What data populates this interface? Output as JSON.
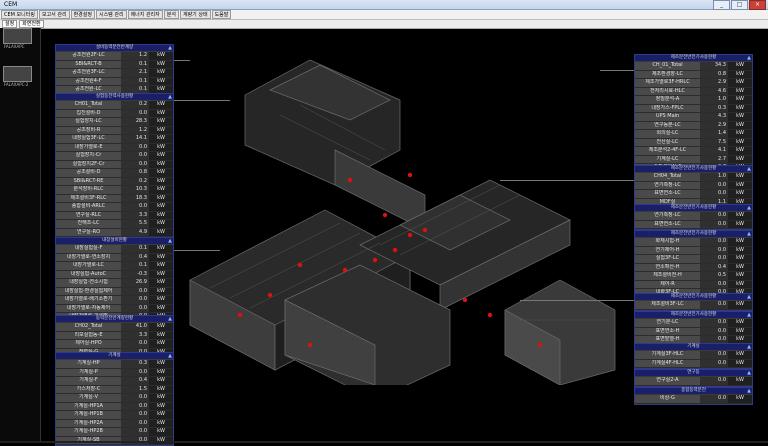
{
  "window": {
    "title": "CEM",
    "buttons": [
      "_",
      "□",
      "×"
    ]
  },
  "menubar": {
    "items": [
      "CEM 모니터링",
      "보고서 관리",
      "환경설정",
      "시스템 관리",
      "에너지 관리자",
      "분석",
      "계량기 상태",
      "도움말"
    ]
  },
  "toolbar": {
    "items": [
      "설정",
      "화면전환"
    ]
  },
  "thumbnails": [
    {
      "label": "FALAXAPC"
    },
    {
      "label": "FALAXAPC-2"
    }
  ],
  "panels": {
    "p1": {
      "title": "설비동력분전반계량",
      "rows": [
        {
          "name": "공조전원2F-LC",
          "value": "1.2",
          "unit": "kW"
        },
        {
          "name": "SBI&RCT-B",
          "value": "0.1",
          "unit": "kW"
        },
        {
          "name": "공조전원3F-LC",
          "value": "2.1",
          "unit": "kW"
        },
        {
          "name": "공조전원4-F",
          "value": "0.1",
          "unit": "kW"
        },
        {
          "name": "공조전원-LC",
          "value": "0.1",
          "unit": "kW"
        }
      ]
    },
    "p2": {
      "title": "실험동전력사용현황",
      "rows": [
        {
          "name": "CH01_Total",
          "value": "0.2",
          "unit": "kW"
        },
        {
          "name": "집진설비-D",
          "value": "0.0",
          "unit": "kW"
        },
        {
          "name": "실험장치-LC",
          "value": "28.3",
          "unit": "kW"
        },
        {
          "name": "공조장비-R",
          "value": "1.2",
          "unit": "kW"
        },
        {
          "name": "내장실험3F-LC",
          "value": "14.1",
          "unit": "kW"
        },
        {
          "name": "내장가열로-E",
          "value": "0.0",
          "unit": "kW"
        },
        {
          "name": "실험장치-Cr",
          "value": "0.0",
          "unit": "kW"
        },
        {
          "name": "실험장치2F-Cr",
          "value": "0.0",
          "unit": "kW"
        },
        {
          "name": "공조설비-D",
          "value": "0.8",
          "unit": "kW"
        },
        {
          "name": "SBI&RCT-RE",
          "value": "0.2",
          "unit": "kW"
        },
        {
          "name": "분석장비-RLC",
          "value": "10.3",
          "unit": "kW"
        },
        {
          "name": "제조설비3F-RLC",
          "value": "18.3",
          "unit": "kW"
        },
        {
          "name": "종합설비-ARLC",
          "value": "0.0",
          "unit": "kW"
        },
        {
          "name": "연구실-RLC",
          "value": "3.3",
          "unit": "kW"
        },
        {
          "name": "전해조-LC",
          "value": "5.5",
          "unit": "kW"
        },
        {
          "name": "연구실-RO",
          "value": "4.9",
          "unit": "kW"
        },
        {
          "name": "시험-R",
          "value": "3.8",
          "unit": "kW"
        },
        {
          "name": "내장가열로-Eq",
          "value": "0.0",
          "unit": "kW"
        }
      ]
    },
    "p3": {
      "title": "내장설비현황",
      "rows": [
        {
          "name": "내장실험실-F",
          "value": "0.1",
          "unit": "kW"
        },
        {
          "name": "내장가열로-연소장치",
          "value": "0.4",
          "unit": "kW"
        },
        {
          "name": "내장가열로-LC",
          "value": "0.1",
          "unit": "kW"
        },
        {
          "name": "내장실험-AutoC",
          "value": "-0.3",
          "unit": "kW"
        },
        {
          "name": "내장실험-연소시험",
          "value": "26.9",
          "unit": "kW"
        },
        {
          "name": "내장실험-환경실험제어",
          "value": "0.0",
          "unit": "kW"
        },
        {
          "name": "내장가열로-배기소환기",
          "value": "0.0",
          "unit": "kW"
        },
        {
          "name": "내장가열로-자동제어",
          "value": "0.0",
          "unit": "kW"
        },
        {
          "name": "내장가열로-기류발",
          "value": "0.0",
          "unit": "kW"
        }
      ]
    },
    "p4": {
      "title": "동력분전반계량현황",
      "rows": [
        {
          "name": "CH02_Total",
          "value": "41.0",
          "unit": "kW"
        },
        {
          "name": "리보실험동-E",
          "value": "3.3",
          "unit": "kW"
        },
        {
          "name": "제어실-HPO",
          "value": "0.0",
          "unit": "kW"
        },
        {
          "name": "전력실-G",
          "value": "0.0",
          "unit": "kW"
        }
      ]
    },
    "p5": {
      "title": "기계실",
      "rows": [
        {
          "name": "기계실-HP",
          "value": "0.3",
          "unit": "kW"
        },
        {
          "name": "기계실-P",
          "value": "0.0",
          "unit": "kW"
        },
        {
          "name": "기계실-F",
          "value": "0.4",
          "unit": "kW"
        },
        {
          "name": "가스저장-C",
          "value": "1.5",
          "unit": "kW"
        },
        {
          "name": "기계실-V",
          "value": "0.0",
          "unit": "kW"
        },
        {
          "name": "기계실-HP1A",
          "value": "0.0",
          "unit": "kW"
        },
        {
          "name": "기계실-HP1B",
          "value": "0.0",
          "unit": "kW"
        },
        {
          "name": "기계실-HP2A",
          "value": "0.0",
          "unit": "kW"
        },
        {
          "name": "기계실-HP2B",
          "value": "0.0",
          "unit": "kW"
        },
        {
          "name": "기계실-SB",
          "value": "0.0",
          "unit": "kW"
        }
      ]
    },
    "r1": {
      "title": "제조분전반전기사용현황",
      "rows": [
        {
          "name": "CH_01_Total",
          "value": "34.3",
          "unit": "kW"
        },
        {
          "name": "제조환경장-LC",
          "value": "0.8",
          "unit": "kW"
        },
        {
          "name": "제조가열로3F-HRLC",
          "value": "2.9",
          "unit": "kW"
        },
        {
          "name": "전처리시료-HLC",
          "value": "4.6",
          "unit": "kW"
        },
        {
          "name": "정밀분석-A",
          "value": "1.0",
          "unit": "kW"
        },
        {
          "name": "내장가스-FPLC",
          "value": "0.3",
          "unit": "kW"
        },
        {
          "name": "UPS Main",
          "value": "4.3",
          "unit": "kW"
        },
        {
          "name": "연구동분-LC",
          "value": "2.9",
          "unit": "kW"
        },
        {
          "name": "회의실-LC",
          "value": "1.4",
          "unit": "kW"
        },
        {
          "name": "전산실-LC",
          "value": "7.5",
          "unit": "kW"
        },
        {
          "name": "제조분석2-4F-LC",
          "value": "4.1",
          "unit": "kW"
        },
        {
          "name": "기계실-LC",
          "value": "2.7",
          "unit": "kW"
        },
        {
          "name": "종합설비실-E",
          "value": "0.7",
          "unit": "kW"
        }
      ]
    },
    "r2": {
      "title": "제조분전반전기사용현황",
      "rows": [
        {
          "name": "CH04_Total",
          "value": "1.0",
          "unit": "kW"
        },
        {
          "name": "연기측정-LC",
          "value": "0.0",
          "unit": "kW"
        },
        {
          "name": "표면연소-LC",
          "value": "0.0",
          "unit": "kW"
        },
        {
          "name": "MDF실",
          "value": "1.1",
          "unit": "kW"
        }
      ]
    },
    "r3": {
      "title": "제조분전반전기사용현황",
      "rows": [
        {
          "name": "연기측정-LC",
          "value": "0.0",
          "unit": "kW"
        },
        {
          "name": "표면연소-LC",
          "value": "0.0",
          "unit": "kW"
        }
      ]
    },
    "r4": {
      "title": "제조분전반전기사용현황",
      "rows": [
        {
          "name": "화재시험-H",
          "value": "0.0",
          "unit": "kW"
        },
        {
          "name": "연기제어-H",
          "value": "0.0",
          "unit": "kW"
        },
        {
          "name": "실험3F-LC",
          "value": "0.0",
          "unit": "kW"
        },
        {
          "name": "연소확산-H",
          "value": "0.4",
          "unit": "kW"
        },
        {
          "name": "제조설비전-H",
          "value": "0.5",
          "unit": "kW"
        },
        {
          "name": "제어-R",
          "value": "0.0",
          "unit": "kW"
        },
        {
          "name": "내화3F-LC",
          "value": "0.0",
          "unit": "kW"
        }
      ]
    },
    "r5": {
      "title": "제조분전반전기사용현황",
      "rows": [
        {
          "name": "제조설비3F-LC",
          "value": "0.0",
          "unit": "kW"
        }
      ]
    },
    "r6": {
      "title": "제조분전반전기사용현황",
      "rows": [
        {
          "name": "연기분-LC",
          "value": "0.0",
          "unit": "kW"
        },
        {
          "name": "표면연소-H",
          "value": "0.0",
          "unit": "kW"
        },
        {
          "name": "표면발열-H",
          "value": "0.0",
          "unit": "kW"
        }
      ]
    },
    "r7": {
      "title": "기계실",
      "rows": [
        {
          "name": "기계실3F-HLC",
          "value": "0.0",
          "unit": "kW"
        },
        {
          "name": "기계실4F-HLC",
          "value": "0.0",
          "unit": "kW"
        }
      ]
    },
    "r8": {
      "title": "연구동",
      "rows": [
        {
          "name": "연구실2-A",
          "value": "0.0",
          "unit": "kW"
        }
      ]
    },
    "r9": {
      "title": "종합동력분전",
      "rows": [
        {
          "name": "비상-G",
          "value": "0.0",
          "unit": "kW"
        }
      ]
    }
  }
}
